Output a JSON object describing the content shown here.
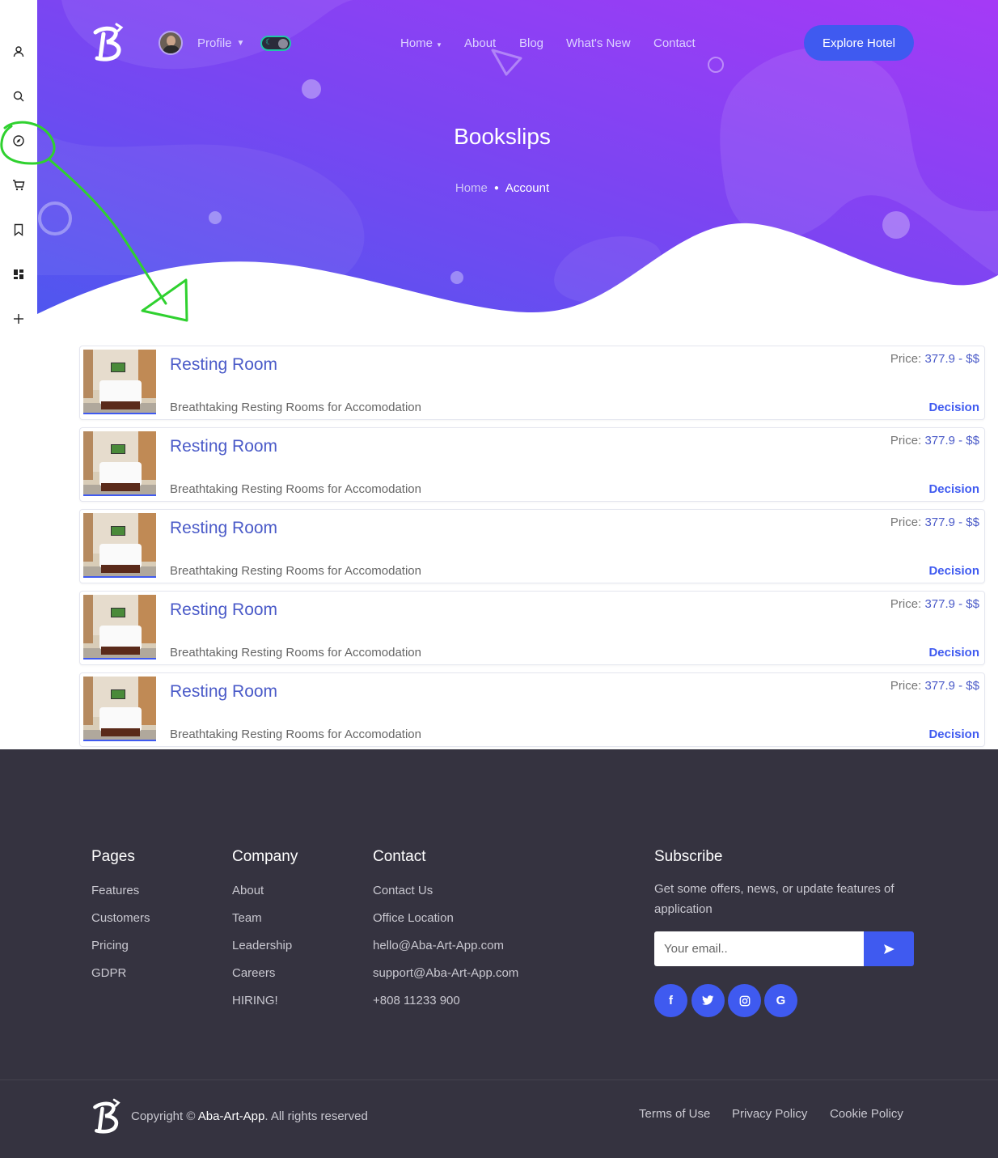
{
  "sidebar": {
    "icons": [
      "user-icon",
      "search-icon",
      "compass-icon",
      "cart-icon",
      "bookmark-icon",
      "dashboard-icon",
      "plus-icon"
    ]
  },
  "header": {
    "profile_label": "Profile",
    "nav": [
      "Home",
      "About",
      "Blog",
      "What's New",
      "Contact"
    ],
    "explore_label": "Explore Hotel"
  },
  "hero": {
    "title": "Bookslips",
    "breadcrumb": {
      "home": "Home",
      "current": "Account"
    }
  },
  "listings": [
    {
      "title": "Resting Room",
      "description": "Breathtaking Resting Rooms for Accomodation",
      "price_label": "Price:",
      "price_value": "377.9 - $$",
      "action": "Decision"
    },
    {
      "title": "Resting Room",
      "description": "Breathtaking Resting Rooms for Accomodation",
      "price_label": "Price:",
      "price_value": "377.9 - $$",
      "action": "Decision"
    },
    {
      "title": "Resting Room",
      "description": "Breathtaking Resting Rooms for Accomodation",
      "price_label": "Price:",
      "price_value": "377.9 - $$",
      "action": "Decision"
    },
    {
      "title": "Resting Room",
      "description": "Breathtaking Resting Rooms for Accomodation",
      "price_label": "Price:",
      "price_value": "377.9 - $$",
      "action": "Decision"
    },
    {
      "title": "Resting Room",
      "description": "Breathtaking Resting Rooms for Accomodation",
      "price_label": "Price:",
      "price_value": "377.9 - $$",
      "action": "Decision"
    }
  ],
  "footer": {
    "pages": {
      "heading": "Pages",
      "links": [
        "Features",
        "Customers",
        "Pricing",
        "GDPR"
      ]
    },
    "company": {
      "heading": "Company",
      "links": [
        "About",
        "Team",
        "Leadership",
        "Careers",
        "HIRING!"
      ]
    },
    "contact": {
      "heading": "Contact",
      "links": [
        "Contact Us",
        "Office Location",
        "hello@Aba-Art-App.com",
        "support@Aba-Art-App.com",
        "+808 11233 900"
      ]
    },
    "subscribe": {
      "heading": "Subscribe",
      "text": "Get some offers, news, or update features of application",
      "placeholder": "Your email..",
      "send_icon": "send-icon"
    },
    "social": [
      "facebook-icon",
      "twitter-icon",
      "instagram-icon",
      "google-icon"
    ],
    "copyright": {
      "prefix": "Copyright ©",
      "brand": "Aba-Art-App",
      "suffix": ". All rights reserved"
    },
    "legal": [
      "Terms of Use",
      "Privacy Policy",
      "Cookie Policy"
    ]
  },
  "colors": {
    "accent": "#3f5af0",
    "hero_start": "#5b4ef0",
    "hero_end": "#a03cf5",
    "footer_bg": "#353340",
    "annotation": "#2fd12f"
  }
}
